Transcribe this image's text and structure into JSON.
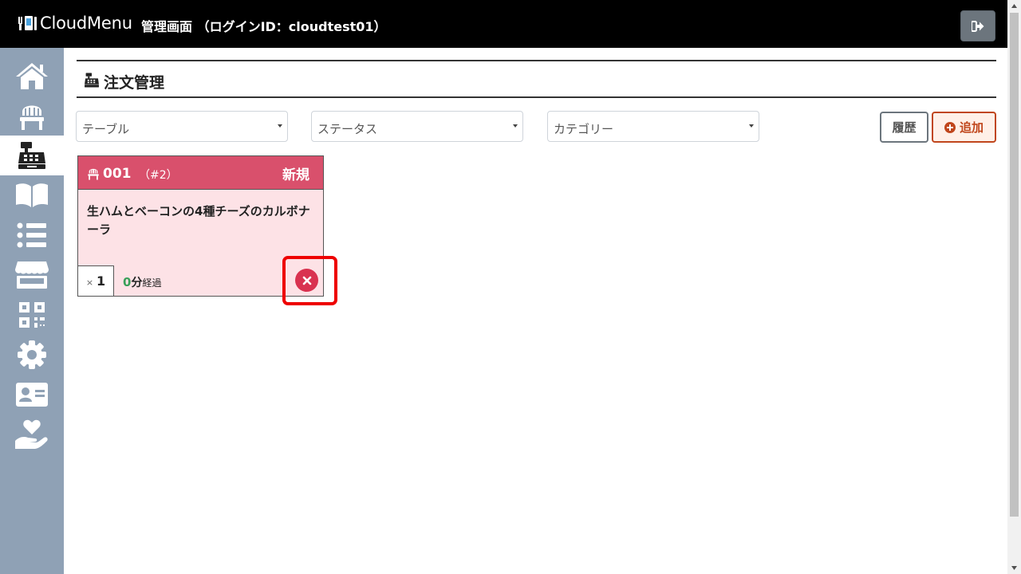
{
  "header": {
    "logo_text": "CloudMenu",
    "title": "管理画面 （ログインID：cloudtest01）",
    "logout_icon": "sign-out-icon"
  },
  "sidebar": {
    "items": [
      {
        "name": "home",
        "icon": "home-icon"
      },
      {
        "name": "tables",
        "icon": "chair-icon"
      },
      {
        "name": "orders",
        "icon": "cash-register-icon",
        "active": true
      },
      {
        "name": "menu",
        "icon": "book-open-icon"
      },
      {
        "name": "list",
        "icon": "list-icon"
      },
      {
        "name": "store",
        "icon": "store-icon"
      },
      {
        "name": "qr",
        "icon": "qrcode-icon"
      },
      {
        "name": "settings",
        "icon": "gear-icon"
      },
      {
        "name": "staff",
        "icon": "id-card-icon"
      },
      {
        "name": "support",
        "icon": "hand-holding-heart-icon"
      }
    ]
  },
  "page": {
    "title": "注文管理",
    "title_icon": "cash-register-icon"
  },
  "filters": {
    "table": "テーブル",
    "status": "ステータス",
    "category": "カテゴリー"
  },
  "buttons": {
    "history": "履歴",
    "add": "追加"
  },
  "orders": [
    {
      "table_no": "001",
      "order_no": "（#2）",
      "status": "新規",
      "item_name": "生ハムとベーコンの4種チーズのカルボナーラ",
      "qty_prefix": "×",
      "qty": "1",
      "elapsed_value": "0",
      "elapsed_unit": "分",
      "elapsed_suffix": "経過"
    }
  ],
  "colors": {
    "header_bg": "#000000",
    "sidebar_bg": "#8fa1b5",
    "card_header": "#d9506c",
    "card_body": "#fde2e6",
    "add_accent": "#c0461c",
    "cancel": "#d93250",
    "highlight": "#ee0000"
  }
}
